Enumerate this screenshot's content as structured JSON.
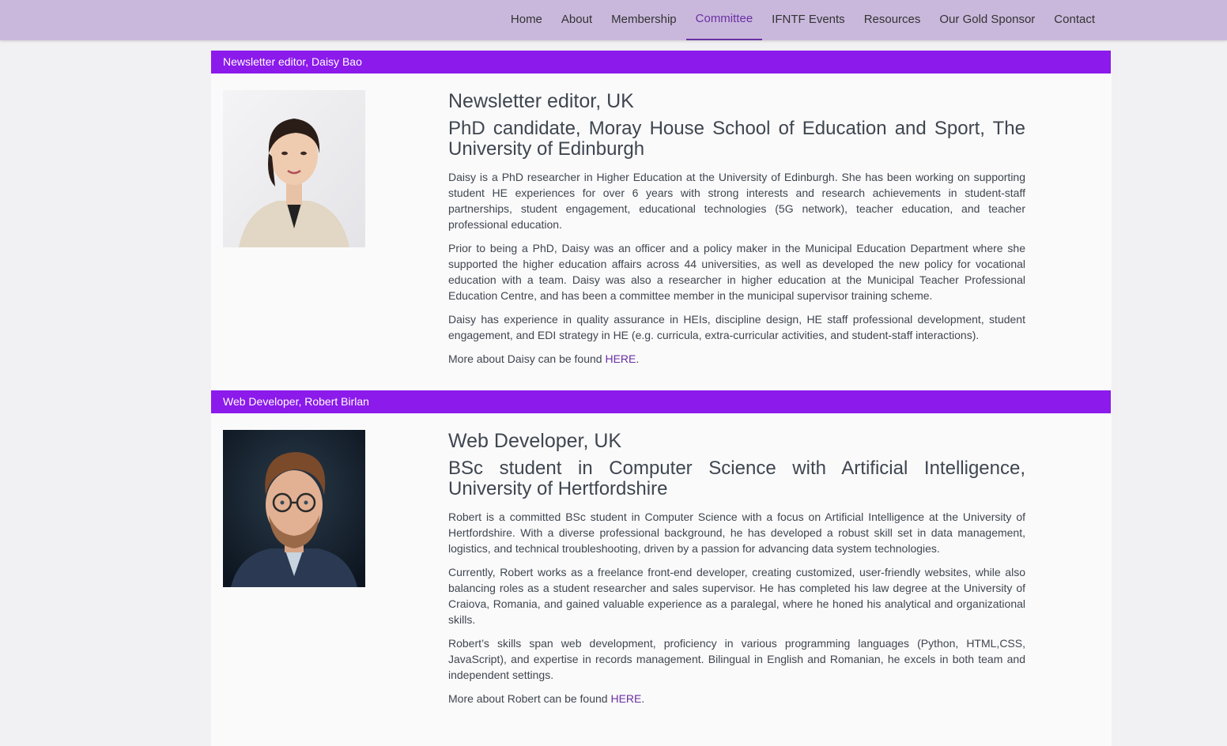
{
  "nav": {
    "items": [
      "Home",
      "About",
      "Membership",
      "Committee",
      "IFNTF Events",
      "Resources",
      "Our Gold Sponsor",
      "Contact"
    ],
    "active": "Committee"
  },
  "members": [
    {
      "bar_title": "Newsletter editor, Daisy Bao",
      "role": "Newsletter editor, UK",
      "affiliation": "PhD candidate, Moray House School of Education and Sport, The University of Edinburgh",
      "paragraphs": [
        "Daisy is a PhD researcher in Higher Education at the University of Edinburgh. She has been working on supporting student HE experiences for over 6 years with strong interests and research achievements in student-staff partnerships, student engagement, educational technologies (5G network), teacher education, and teacher professional education.",
        "Prior to being a PhD, Daisy was an officer and a policy maker in the Municipal Education Department where she supported the higher education affairs across 44 universities, as well as developed the new policy for vocational education with a team. Daisy was also a researcher in higher education at the Municipal Teacher Professional Education Centre, and has been a committee member in the municipal supervisor training scheme.",
        "Daisy has experience in quality assurance in HEIs, discipline design, HE staff professional development, student engagement, and EDI strategy in HE (e.g. curricula, extra-curricular activities, and student-staff interactions)."
      ],
      "more_prefix": "More about Daisy can be found ",
      "more_link": "HERE",
      "more_suffix": "."
    },
    {
      "bar_title": "Web Developer, Robert Birlan",
      "role": "Web Developer, UK",
      "affiliation": "BSc student in Computer Science with Artificial Intelligence, University of Hertfordshire",
      "paragraphs": [
        "Robert is a committed BSc student in Computer Science with a focus on Artificial Intelligence at the University of Hertfordshire. With a diverse professional background, he has developed a robust skill set in data management, logistics, and technical troubleshooting, driven by a passion for advancing data system technologies.",
        "Currently, Robert works as a freelance front-end developer, creating customized, user-friendly websites, while also balancing roles as a student researcher and sales supervisor. He has completed his law degree at the University of Craiova, Romania, and gained valuable experience as a paralegal, where he honed his analytical and organizational skills.",
        "Robert’s skills span web development, proficiency in various programming languages (Python, HTML,CSS, JavaScript), and expertise in records management. Bilingual in English and Romanian, he excels in both team and independent settings."
      ],
      "more_prefix": "More about Robert can be found ",
      "more_link": "HERE",
      "more_suffix": "."
    }
  ]
}
